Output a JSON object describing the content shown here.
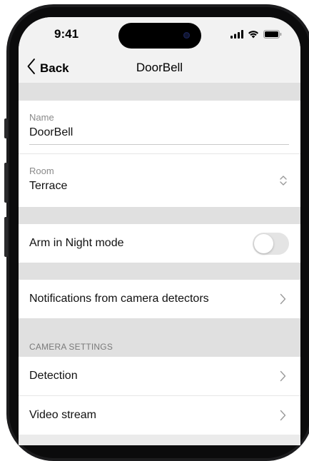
{
  "status_bar": {
    "time": "9:41",
    "icons": [
      "signal-icon",
      "wifi-icon",
      "battery-icon"
    ]
  },
  "nav": {
    "back_label": "Back",
    "title": "DoorBell"
  },
  "fields": {
    "name": {
      "label": "Name",
      "value": "DoorBell"
    },
    "room": {
      "label": "Room",
      "value": "Terrace"
    }
  },
  "settings": {
    "arm_night": {
      "label": "Arm in Night mode",
      "enabled": false
    },
    "notifications": {
      "label": "Notifications from camera detectors"
    }
  },
  "camera_settings": {
    "header": "CAMERA SETTINGS",
    "items": [
      {
        "label": "Detection"
      },
      {
        "label": "Video stream"
      }
    ]
  },
  "colors": {
    "background_gray": "#e0e0e0",
    "toggle_off": "#e4e4e4",
    "chevron": "#9a9a9a"
  }
}
